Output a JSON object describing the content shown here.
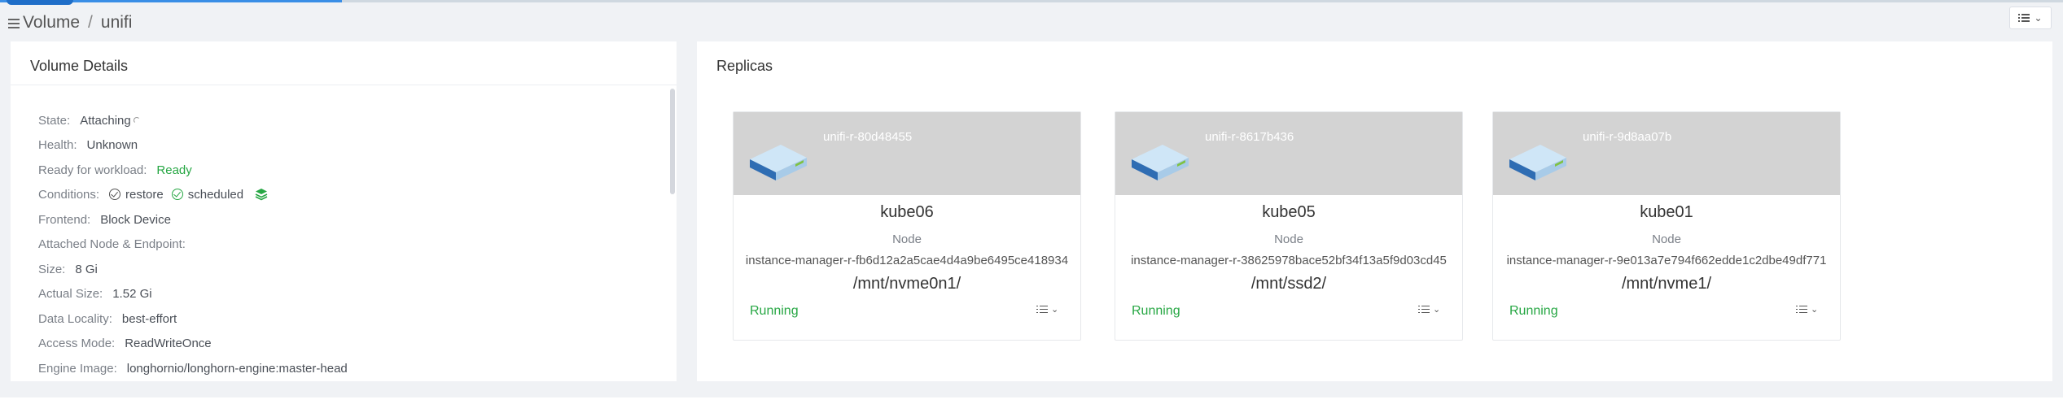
{
  "breadcrumb": {
    "root": "Volume",
    "separator": "/",
    "current": "unifi"
  },
  "details": {
    "title": "Volume Details",
    "rows": {
      "state": {
        "label": "State:",
        "value": "Attaching"
      },
      "health": {
        "label": "Health:",
        "value": "Unknown"
      },
      "ready": {
        "label": "Ready for workload:",
        "value": "Ready"
      },
      "conditions": {
        "label": "Conditions:",
        "restore": "restore",
        "scheduled": "scheduled"
      },
      "frontend": {
        "label": "Frontend:",
        "value": "Block Device"
      },
      "attached": {
        "label": "Attached Node & Endpoint:",
        "value": ""
      },
      "size": {
        "label": "Size:",
        "value": "8 Gi"
      },
      "actual": {
        "label": "Actual Size:",
        "value": "1.52 Gi"
      },
      "locality": {
        "label": "Data Locality:",
        "value": "best-effort"
      },
      "access": {
        "label": "Access Mode:",
        "value": "ReadWriteOnce"
      },
      "engine": {
        "label": "Engine Image:",
        "value": "longhornio/longhorn-engine:master-head"
      }
    }
  },
  "replicas": {
    "title": "Replicas",
    "items": [
      {
        "name": "unifi-r-80d48455",
        "node": "kube06",
        "node_label": "Node",
        "instance": "instance-manager-r-fb6d12a2a5cae4d4a9be6495ce418934",
        "path": "/mnt/nvme0n1/",
        "status": "Running"
      },
      {
        "name": "unifi-r-8617b436",
        "node": "kube05",
        "node_label": "Node",
        "instance": "instance-manager-r-38625978bace52bf34f13a5f9d03cd45",
        "path": "/mnt/ssd2/",
        "status": "Running"
      },
      {
        "name": "unifi-r-9d8aa07b",
        "node": "kube01",
        "node_label": "Node",
        "instance": "instance-manager-r-9e013a7e794f662edde1c2dbe49df771",
        "path": "/mnt/nvme1/",
        "status": "Running"
      }
    ]
  },
  "colors": {
    "accent": "#3a8ee6",
    "running": "#27a744",
    "card_header": "#d3d3d3"
  },
  "icons": {
    "volume": "list-icon",
    "replica": "disk-icon",
    "menu": "list-menu-icon",
    "chevron": "chevron-down-icon",
    "conditions": "layers-icon"
  }
}
